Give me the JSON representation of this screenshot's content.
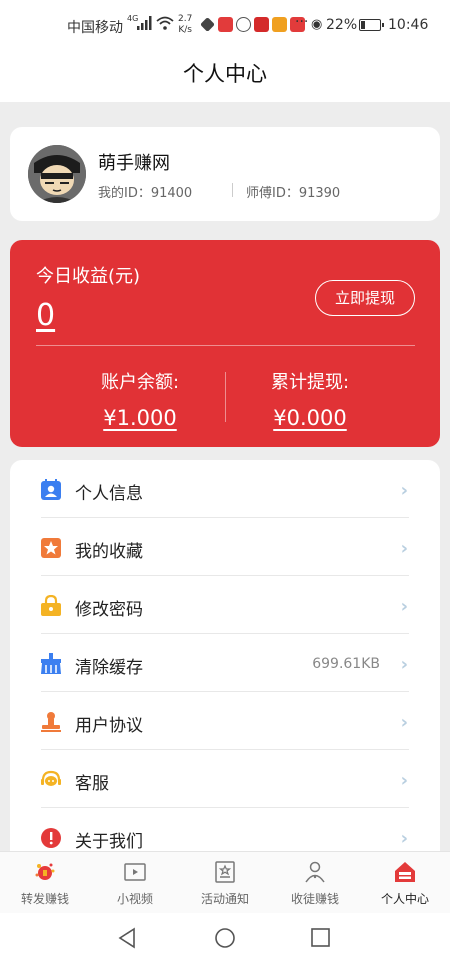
{
  "status_bar": {
    "carrier": "中国移动",
    "network": "4G",
    "speed_value": "2.7",
    "speed_unit": "K/s",
    "battery_percent": "22%",
    "battery_level": 0.22,
    "time": "10:46"
  },
  "header": {
    "title": "个人中心"
  },
  "profile": {
    "name": "萌手赚网",
    "my_id": "我的ID：91400",
    "master_id": "师傅ID：91390"
  },
  "earnings": {
    "today_label": "今日收益(元)",
    "today_value": "0",
    "withdraw_button": "立即提现",
    "balance_label": "账户余额:",
    "balance_value": "¥1.000",
    "total_label": "累计提现:",
    "total_value": "¥0.000",
    "card_color": "#e13236"
  },
  "menu": {
    "items": [
      {
        "label": "个人信息",
        "icon": "user-card-icon",
        "value": ""
      },
      {
        "label": "我的收藏",
        "icon": "star-icon",
        "value": ""
      },
      {
        "label": "修改密码",
        "icon": "lock-icon",
        "value": ""
      },
      {
        "label": "清除缓存",
        "icon": "broom-icon",
        "value": "699.61KB"
      },
      {
        "label": "用户协议",
        "icon": "stamp-icon",
        "value": ""
      },
      {
        "label": "客服",
        "icon": "headset-icon",
        "value": ""
      },
      {
        "label": "关于我们",
        "icon": "info-icon",
        "value": ""
      }
    ]
  },
  "tabbar": {
    "tabs": [
      {
        "label": "转发赚钱",
        "icon": "share-money-icon",
        "active": false
      },
      {
        "label": "小视频",
        "icon": "video-icon",
        "active": false
      },
      {
        "label": "活动通知",
        "icon": "notice-icon",
        "active": false
      },
      {
        "label": "收徒赚钱",
        "icon": "apprentice-icon",
        "active": false
      },
      {
        "label": "个人中心",
        "icon": "home-icon",
        "active": true
      }
    ]
  }
}
